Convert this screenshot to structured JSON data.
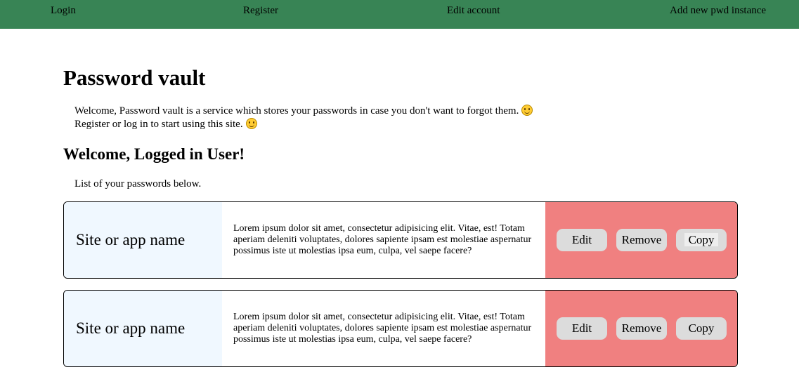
{
  "nav": {
    "login": "Login",
    "register": "Register",
    "edit_account": "Edit account",
    "add_new": "Add new pwd instance"
  },
  "colors": {
    "navbar": "#388455",
    "site_panel": "#f0f8ff",
    "actions_panel": "#f08080",
    "button": "#dcdcdc"
  },
  "title": "Password vault",
  "intro": {
    "line1": "Welcome, Password vault is a service which stores your passwords in case you don't want to forgot them.",
    "line2": "Register or log in to start using this site.",
    "emoji_icon": "smiling-face-icon"
  },
  "welcome": "Welcome, Logged in User!",
  "list_intro": "List of your passwords below.",
  "cards": [
    {
      "site": "Site or app name",
      "description": "Lorem ipsum dolor sit amet, consectetur adipisicing elit. Vitae, est! Totam aperiam deleniti voluptates, dolores sapiente ipsam est molestiae aspernatur possimus iste ut molestias ipsa eum, culpa, vel saepe facere?",
      "edit": "Edit",
      "remove": "Remove",
      "copy": "Copy"
    },
    {
      "site": "Site or app name",
      "description": "Lorem ipsum dolor sit amet, consectetur adipisicing elit. Vitae, est! Totam aperiam deleniti voluptates, dolores sapiente ipsam est molestiae aspernatur possimus iste ut molestias ipsa eum, culpa, vel saepe facere?",
      "edit": "Edit",
      "remove": "Remove",
      "copy": "Copy"
    }
  ]
}
